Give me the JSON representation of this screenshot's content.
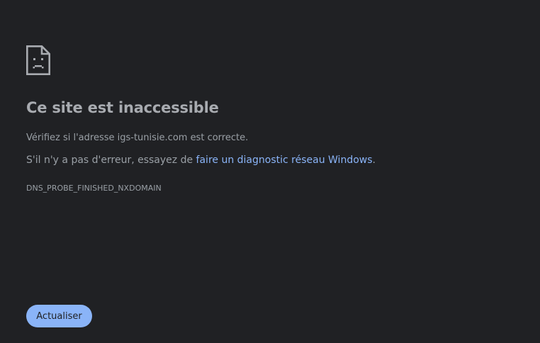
{
  "icon": "sad-page-icon",
  "heading": "Ce site est inaccessible",
  "line1": {
    "text": "Vérifiez si l'adresse igs-tunisie.com est correcte."
  },
  "line2": {
    "prefix": "S'il n'y a pas d'erreur, essayez de ",
    "link_text": "faire un diagnostic réseau Windows",
    "suffix": "."
  },
  "error_code": "DNS_PROBE_FINISHED_NXDOMAIN",
  "reload_button": "Actualiser",
  "colors": {
    "background": "#202124",
    "text": "#9aa0a6",
    "link": "#8ab4f8",
    "button_bg": "#8ab4f8"
  }
}
